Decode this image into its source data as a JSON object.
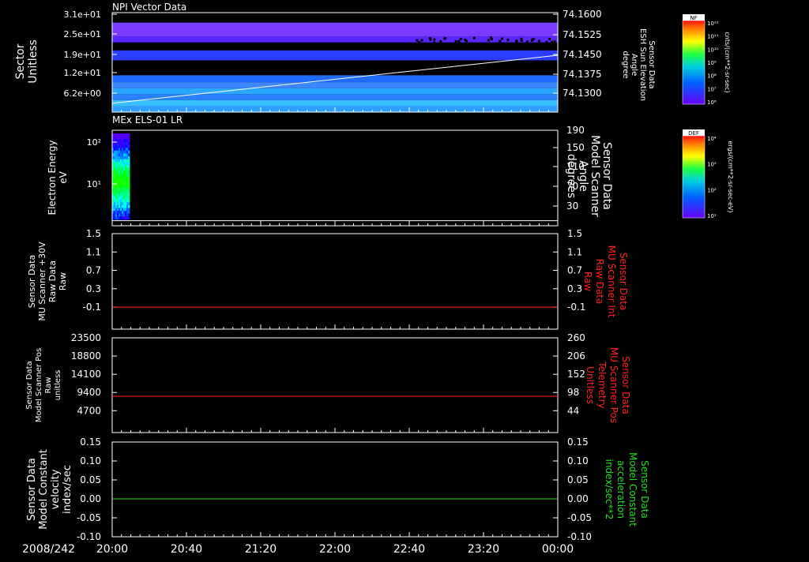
{
  "chart_data": [
    {
      "type": "heatmap",
      "title": "NPI Vector Data",
      "ylabel_left": [
        "Sector",
        "Unitless"
      ],
      "yticks_left": [
        "3.1e+01",
        "2.5e+01",
        "1.9e+01",
        "1.2e+01",
        "6.2e+00"
      ],
      "ylabel_right": [
        "Sensor Data",
        "ESH Sun Elevation",
        "Angle",
        "degree"
      ],
      "yticks_right": [
        "74.1600",
        "74.1525",
        "74.1450",
        "74.1375",
        "74.1300"
      ],
      "overlay_line": {
        "start": 74.1292,
        "end": 74.1455,
        "ylim": [
          74.1262,
          74.16
        ]
      },
      "colorbar": {
        "label": "NF",
        "units": "cnts/(cm**2-sr-sec)",
        "ticks": [
          "10¹²",
          "10¹¹",
          "10¹⁰",
          "10⁹",
          "10⁸",
          "10⁷",
          "10⁶"
        ]
      }
    },
    {
      "type": "heatmap",
      "title": "MEx ELS-01 LR",
      "ylabel_left": [
        "Electron Energy",
        "eV"
      ],
      "yticks_left": [
        "10²",
        "10¹"
      ],
      "ylabel_right": [
        "Sensor Data",
        "Model Scanner",
        "Angle",
        "degrees"
      ],
      "yticks_right": [
        "190",
        "150",
        "110",
        "70",
        "30"
      ],
      "overlay_line": {
        "value": 10,
        "ylim": [
          0,
          190
        ]
      },
      "colorbar": {
        "label": "DEF",
        "units": "ergs/(cm**2-sr-sec-eV)",
        "ticks": [
          "10⁴",
          "10³",
          "10²",
          "10¹"
        ]
      }
    },
    {
      "type": "line",
      "ylabel_left": [
        "Sensor Data",
        "MU Scanner +30V",
        "Raw Data",
        "Raw"
      ],
      "yticks_left": [
        "1.5",
        "1.1",
        "0.7",
        "0.3",
        "-0.1"
      ],
      "ylim_left": [
        -0.45,
        1.5
      ],
      "ylabel_right": [
        "Sensor Data",
        "MU Scanner Int",
        "Raw Data",
        "Raw"
      ],
      "yticks_right": [
        "1.5",
        "1.1",
        "0.7",
        "0.3",
        "-0.1"
      ],
      "series": [
        {
          "value": 0.0,
          "color": "#ff2020"
        }
      ],
      "right_label_color": "#ff2020"
    },
    {
      "type": "line",
      "ylabel_left": [
        "Sensor Data",
        "Model Scanner Pos",
        "Raw",
        "unitless"
      ],
      "yticks_left": [
        "23500",
        "18800",
        "14100",
        "9400",
        "4700"
      ],
      "ylim_left": [
        -1000,
        23500
      ],
      "ylabel_right": [
        "Sensor Data",
        "MU Scanner Pos",
        "Telemetry",
        "Unitless"
      ],
      "yticks_right": [
        "260",
        "206",
        "152",
        "98",
        "44"
      ],
      "series": [
        {
          "value": 8400,
          "color": "#ff2020"
        }
      ],
      "right_label_color": "#ff2020"
    },
    {
      "type": "line",
      "ylabel_left": [
        "Sensor Data",
        "Model Constant",
        "velocity",
        "index/sec"
      ],
      "yticks_left": [
        "0.15",
        "0.10",
        "0.05",
        "0.00",
        "-0.05",
        "-0.10"
      ],
      "ylim_left": [
        -0.1,
        0.15
      ],
      "ylabel_right": [
        "Sensor Data",
        "Model Constant",
        "acceleration",
        "index/sec**2"
      ],
      "yticks_right": [
        "0.15",
        "0.10",
        "0.05",
        "0.00",
        "-0.05",
        "-0.10"
      ],
      "series": [
        {
          "value": 0.0,
          "color": "#20e020"
        }
      ],
      "right_label_color": "#20e020"
    }
  ],
  "xaxis": {
    "date": "2008/242",
    "ticks": [
      "20:00",
      "20:40",
      "21:20",
      "22:00",
      "22:40",
      "23:20",
      "00:00"
    ],
    "range_hours": [
      20,
      24
    ]
  }
}
